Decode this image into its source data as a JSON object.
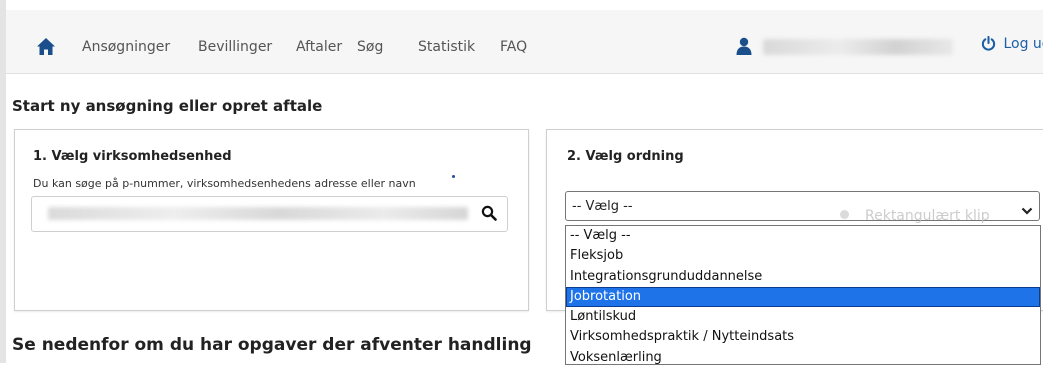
{
  "nav": {
    "home_icon": "home-icon",
    "items": [
      {
        "label": "Ansøgninger"
      },
      {
        "label": "Bevillinger"
      },
      {
        "label": "Aftaler"
      },
      {
        "label": "Søg"
      },
      {
        "label": "Statistik"
      },
      {
        "label": "FAQ"
      }
    ],
    "user_icon": "user-icon",
    "logout_icon": "power-icon",
    "logout_label": "Log ud"
  },
  "main": {
    "title": "Start ny ansøgning eller opret aftale",
    "panel1": {
      "heading": "1. Vælg virksomhedsenhed",
      "hint": "Du kan søge på p-nummer, virksomhedsenhedens adresse eller navn",
      "search_icon": "search-icon"
    },
    "panel2": {
      "heading": "2. Vælg ordning",
      "select_value": "-- Vælg --",
      "overlay_text": "Rektangulært klip",
      "options": [
        {
          "label": "-- Vælg --",
          "selected": false
        },
        {
          "label": "Fleksjob",
          "selected": false
        },
        {
          "label": "Integrationsgrunduddannelse",
          "selected": false
        },
        {
          "label": "Jobrotation",
          "selected": true
        },
        {
          "label": "Løntilskud",
          "selected": false
        },
        {
          "label": "Virksomhedspraktik / Nytteindsats",
          "selected": false
        },
        {
          "label": "Voksenlærling",
          "selected": false
        }
      ]
    },
    "tasks_title": "Se nedenfor om du har opgaver der afventer handling"
  },
  "colors": {
    "accent": "#1d5fa6",
    "highlight": "#1e73e8",
    "nav_icon": "#1b4f8c"
  }
}
